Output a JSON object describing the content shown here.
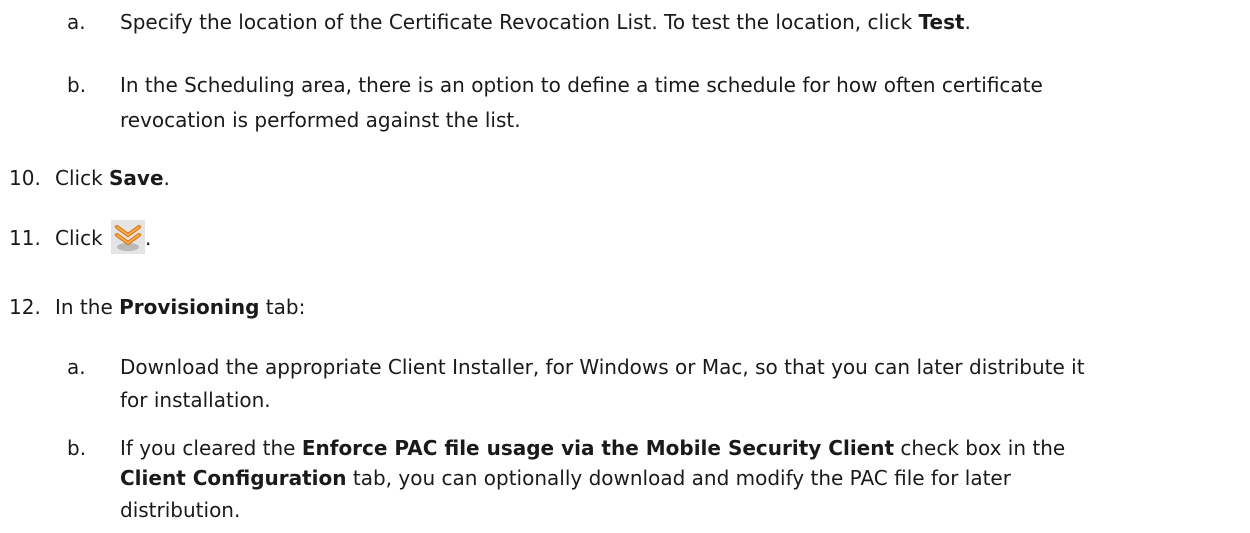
{
  "steps": {
    "s9a": {
      "marker": "a.",
      "pre": "Specify the location of the Certificate Revocation List. To test the location, click ",
      "bold": "Test",
      "post": "."
    },
    "s9b": {
      "marker": "b.",
      "line1": "In the Scheduling area, there is an option to define a time schedule for how often certificate",
      "line2": "revocation is performed against the list."
    },
    "s10": {
      "marker": "10.",
      "pre": "Click ",
      "bold": "Save",
      "post": "."
    },
    "s11": {
      "marker": "11.",
      "pre": "Click ",
      "icon": "double-chevron-down-icon",
      "post": "."
    },
    "s12": {
      "marker": "12.",
      "pre": "In the ",
      "bold": "Provisioning",
      "post": " tab:"
    },
    "s12a": {
      "marker": "a.",
      "line1": "Download the appropriate Client Installer, for Windows or Mac, so that you can later distribute it",
      "line2": "for installation."
    },
    "s12b": {
      "marker": "b.",
      "l1_pre": "If you cleared the ",
      "l1_bold": "Enforce PAC file usage via the Mobile Security Client",
      "l1_post": " check box in the",
      "l2_bold": "Client Configuration",
      "l2_post": " tab, you can optionally download and modify the PAC file for later",
      "line3": "distribution."
    }
  },
  "colors": {
    "text": "#1a1a1a",
    "icon_accent": "#e07a10",
    "icon_bg": "#d8d8d8"
  }
}
